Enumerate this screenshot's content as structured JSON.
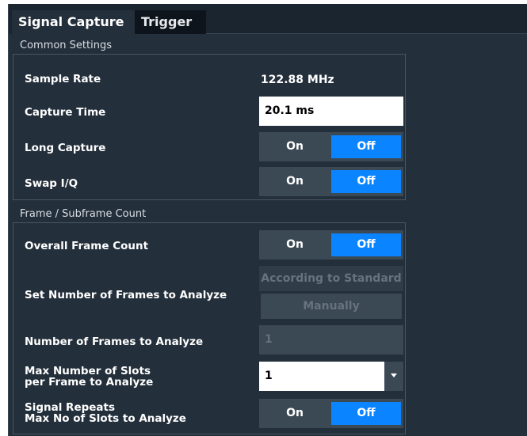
{
  "tabs": [
    {
      "label": "Signal Capture",
      "active": true
    },
    {
      "label": "Trigger",
      "active": false
    }
  ],
  "common_settings": {
    "title": "Common Settings",
    "sample_rate": {
      "label": "Sample Rate",
      "value": "122.88 MHz"
    },
    "capture_time": {
      "label": "Capture Time",
      "value": "20.1 ms"
    },
    "long_capture": {
      "label": "Long Capture",
      "on": "On",
      "off": "Off",
      "selected": "Off"
    },
    "swap_iq": {
      "label": "Swap I/Q",
      "on": "On",
      "off": "Off",
      "selected": "Off"
    }
  },
  "frame_count": {
    "title": "Frame / Subframe Count",
    "overall_frame_count": {
      "label": "Overall Frame Count",
      "on": "On",
      "off": "Off",
      "selected": "Off"
    },
    "set_number_frames": {
      "label": "Set Number of Frames to Analyze",
      "according_to_standard": "According to Standard",
      "manually": "Manually"
    },
    "number_of_frames": {
      "label": "Number of Frames to Analyze",
      "value": "1"
    },
    "max_slots": {
      "label_line1": "Max Number of Slots",
      "label_line2": "per Frame to Analyze",
      "value": "1"
    },
    "signal_repeats": {
      "label_line1": "Signal Repeats",
      "label_line2": "Max No of Slots to Analyze",
      "on": "On",
      "off": "Off",
      "selected": "Off"
    }
  },
  "colors": {
    "accent": "#0a84ff",
    "panel_bg": "#232f3b",
    "dark_bg": "#1b2530",
    "control_bg": "#3b4955"
  },
  "icons": {
    "dropdown": "chevron-down-icon"
  }
}
